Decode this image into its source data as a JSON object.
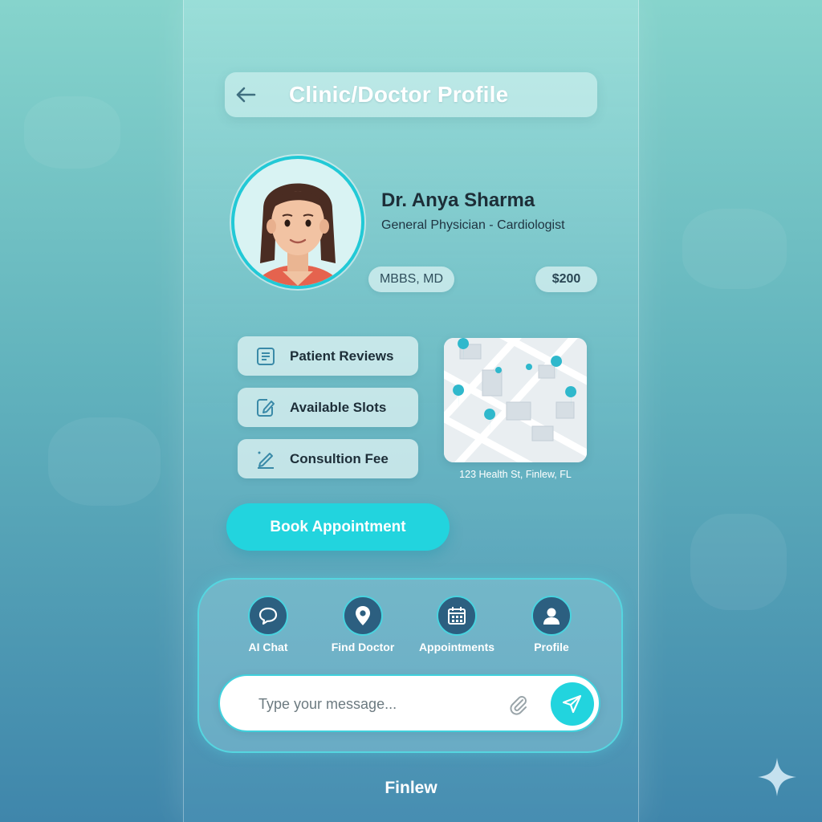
{
  "header": {
    "title": "Clinic/Doctor Profile",
    "back_icon": "arrow-left-icon"
  },
  "doctor": {
    "name": "Dr. Anya Sharma",
    "specialty": "General Physician - Cardiologist",
    "qualification": "MBBS, MD",
    "fee": "$200"
  },
  "actions": [
    {
      "label": "Patient Reviews",
      "icon": "reviews-icon"
    },
    {
      "label": "Available Slots",
      "icon": "calendar-edit-icon"
    },
    {
      "label": "Consultion Fee",
      "icon": "pen-icon"
    }
  ],
  "location": {
    "address": "123 Health St, Finlew, FL"
  },
  "book_button": "Book Appointment",
  "bottom_nav": [
    {
      "label": "AI Chat",
      "icon": "chat-bubble-icon"
    },
    {
      "label": "Find Doctor",
      "icon": "location-pin-icon"
    },
    {
      "label": "Appointments",
      "icon": "calendar-icon"
    },
    {
      "label": "Profile",
      "icon": "user-icon"
    }
  ],
  "message": {
    "placeholder": "Type your message..."
  },
  "brand": "Finlew",
  "colors": {
    "accent": "#22d4de",
    "nav_circle": "#2c5f80",
    "text_dark": "#1d2e38"
  }
}
